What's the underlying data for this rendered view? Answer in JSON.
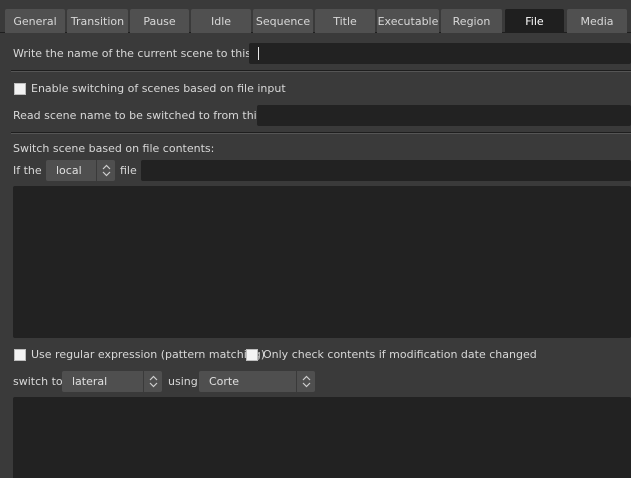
{
  "tabs": [
    {
      "label": "General",
      "active": false
    },
    {
      "label": "Transition",
      "active": false
    },
    {
      "label": "Pause",
      "active": false
    },
    {
      "label": "Idle",
      "active": false
    },
    {
      "label": "Sequence",
      "active": false
    },
    {
      "label": "Title",
      "active": false
    },
    {
      "label": "Executable",
      "active": false
    },
    {
      "label": "Region",
      "active": false
    },
    {
      "label": "File",
      "active": true
    },
    {
      "label": "Media",
      "active": false
    }
  ],
  "write_section": {
    "label": "Write the name of the current scene to this file:",
    "value": ""
  },
  "read_section": {
    "enable_label": "Enable switching of scenes based on file input",
    "enable_checked": false,
    "read_label": "Read scene name to be switched to from this file:",
    "read_value": ""
  },
  "content_section": {
    "heading": "Switch scene based on file contents:",
    "if_label": "If the",
    "location_value": "local",
    "file_label": "file",
    "file_value": "",
    "content_text": "",
    "regex_label": "Use regular expression (pattern matching)",
    "regex_checked": false,
    "modified_label": "Only check contents if modification date changed",
    "modified_checked": false,
    "switch_to_label": "switch to",
    "scene_value": "lateral",
    "using_label": "using",
    "transition_value": "Corte",
    "list_text": ""
  },
  "colors": {
    "background": "#3a3a3a",
    "tab": "#505050",
    "tab_active": "#1f1f1f",
    "field": "#222222",
    "combo": "#4f4f4f",
    "text": "#d8d8d8"
  }
}
